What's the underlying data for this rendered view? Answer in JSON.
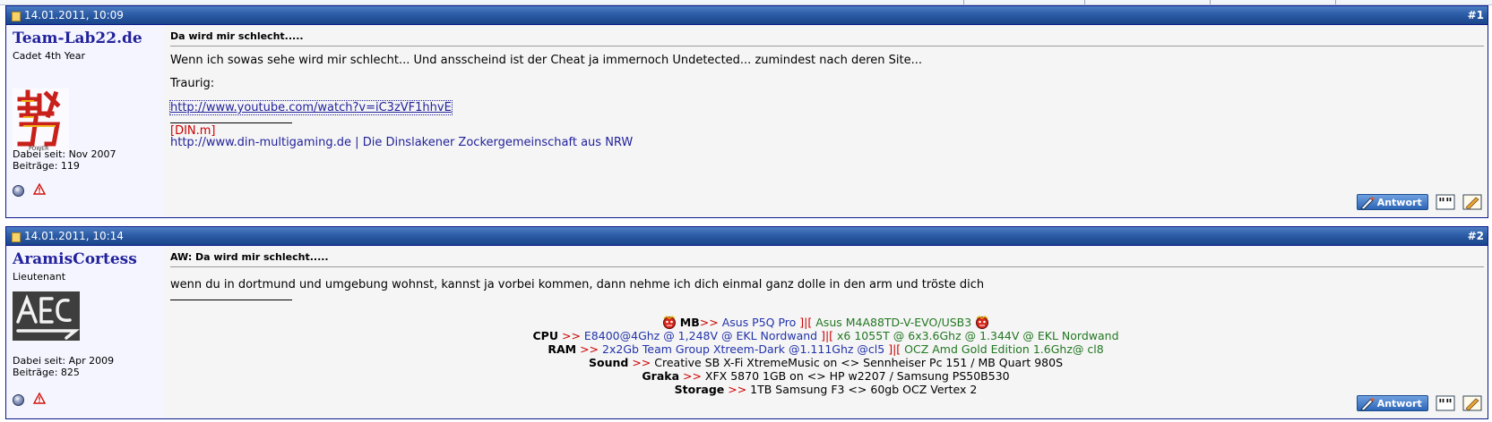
{
  "posts": [
    {
      "date": "14.01.2011, 10:09",
      "number": "#1",
      "user": {
        "name": "Team-Lab22.de",
        "rank": "Cadet 4th Year",
        "joined": "Dabei seit: Nov 2007",
        "posts": "Beiträge: 119"
      },
      "title": "Da wird mir schlecht.....",
      "body_lines": [
        "Wenn ich sowas sehe wird mir schlecht... Und ansscheind ist der Cheat ja immernoch Undetected... zumindest nach deren Site...",
        "Traurig:"
      ],
      "link": "http://www.youtube.com/watch?v=iC3zVF1hhvE",
      "signature": {
        "tag": "[DIN.m]",
        "link": "http://www.din-multigaming.de | Die Dinslakener Zockergemeinschaft aus NRW"
      },
      "answer_label": "Antwort"
    },
    {
      "date": "14.01.2011, 10:14",
      "number": "#2",
      "user": {
        "name": "AramisCortess",
        "rank": "Lieutenant",
        "joined": "Dabei seit: Apr 2009",
        "posts": "Beiträge: 825"
      },
      "title": "AW: Da wird mir schlecht.....",
      "body": "wenn du in dortmund und umgebung wohnst, kannst ja vorbei kommen, dann nehme ich dich einmal ganz dolle in den arm und tröste dich",
      "signature": {
        "mb": {
          "label": "MB",
          "arrow": ">>",
          "v1": "Asus P5Q Pro",
          "sep": "]|[",
          "v2": "Asus M4A88TD-V-EVO/USB3"
        },
        "cpu": {
          "label": "CPU",
          "arrow": ">>",
          "v1": "E8400@4Ghz @ 1,248V @ EKL Nordwand",
          "sep": "]|[",
          "v2": "x6 1055T @ 6x3.6Ghz @ 1.344V @ EKL Nordwand"
        },
        "ram": {
          "label": "RAM",
          "arrow": ">>",
          "v1": "2x2Gb Team Group Xtreem-Dark @1.111Ghz @cl5",
          "sep": "]|[",
          "v2": "OCZ Amd Gold Edition 1.6Ghz@ cl8"
        },
        "sound": {
          "label": "Sound",
          "arrow": ">>",
          "value": "Creative SB X-Fi XtremeMusic on <> Sennheiser Pc 151 / MB Quart 980S"
        },
        "graka": {
          "label": "Graka",
          "arrow": ">>",
          "value": "XFX 5870 1GB on <> HP w2207 / Samsung PS50B530"
        },
        "storage": {
          "label": "Storage",
          "arrow": ">>",
          "value": "1TB Samsung F3 <> 60gb OCZ Vertex 2"
        }
      },
      "answer_label": "Antwort"
    }
  ],
  "colors": {
    "header": "#2c5da6",
    "border": "#0b198c",
    "username": "#22229c",
    "signature_red": "#cc0000",
    "signature_green": "#227722"
  },
  "icons": [
    "post-icon",
    "online-status-icon",
    "report-warning-icon",
    "quote-icon",
    "edit-icon",
    "reply-pen-icon",
    "mb-emoji-icon"
  ]
}
